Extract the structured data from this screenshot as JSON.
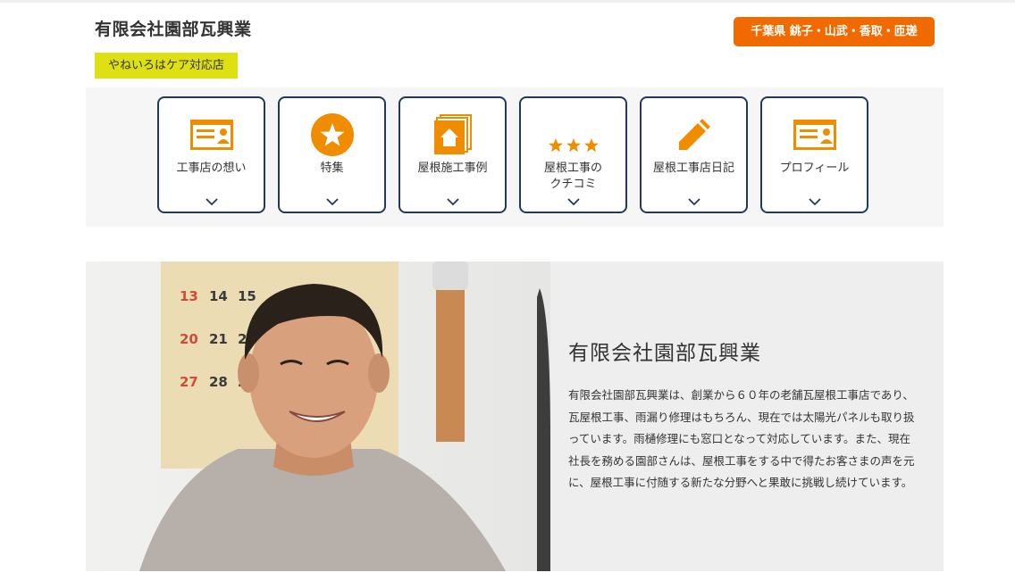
{
  "header": {
    "company_name": "有限会社園部瓦興業",
    "care_badge": "やねいろはケア対応店",
    "area_badge": "千葉県 銚子・山武・香取・匝瑳"
  },
  "colors": {
    "accent_orange": "#f08c00",
    "area_badge_bg": "#f06a00",
    "care_badge_bg": "#dfe013",
    "navy_border": "#1f3a5c"
  },
  "nav": [
    {
      "label": "工事店の想い",
      "icon": "profile-card-icon"
    },
    {
      "label": "特集",
      "icon": "star-circle-icon"
    },
    {
      "label": "屋根施工事例",
      "icon": "house-photos-icon"
    },
    {
      "label": "屋根工事の\nクチコミ",
      "icon": "three-stars-icon"
    },
    {
      "label": "屋根工事店日記",
      "icon": "pencil-icon"
    },
    {
      "label": "プロフィール",
      "icon": "profile-card-icon"
    }
  ],
  "hero": {
    "title": "有限会社園部瓦興業",
    "description": "有限会社園部瓦興業は、創業から６０年の老舗瓦屋根工事店であり、瓦屋根工事、雨漏り修理はもちろん、現在では太陽光パネルも取り扱っています。雨樋修理にも窓口となって対応しています。また、現在社長を務める園部さんは、屋根工事をする中で得たお客さまの声を元に、屋根工事に付随する新たな分野へと果敢に挑戦し続けています。",
    "calendar_numbers": [
      "13",
      "14",
      "15",
      "20",
      "21",
      "22",
      "27",
      "28",
      "29"
    ]
  }
}
